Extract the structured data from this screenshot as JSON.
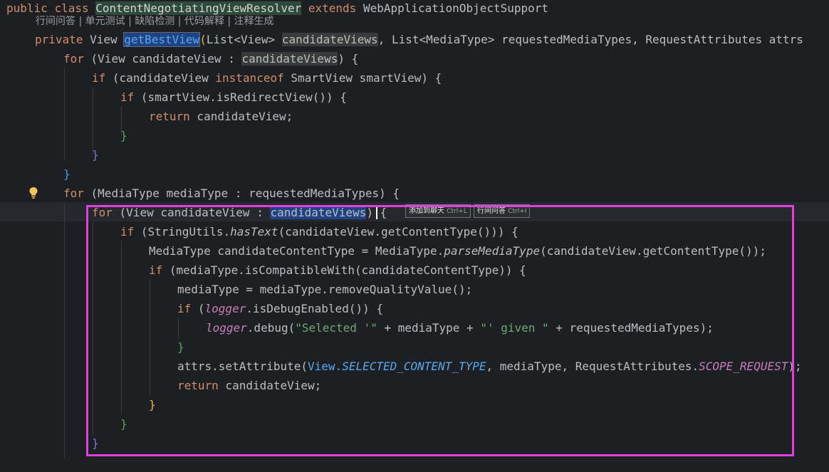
{
  "class_line": {
    "public": "public",
    "class": "class",
    "class_name": "ContentNegotiatingViewResolver",
    "extends": "extends",
    "superclass": "WebApplicationObjectSupport"
  },
  "inlay_hints": {
    "ask": "行间问答",
    "unit_test": "单元测试",
    "bug_detect": "缺陷检测",
    "explain": "代码解释",
    "comment": "注释生成",
    "separator": " | "
  },
  "method_line": {
    "private": "private",
    "return_type": "View",
    "method_name": "getBestView",
    "params_a": "List<View> ",
    "param_candidate_views": "candidateViews",
    "params_b": ", List<MediaType> requestedMediaTypes, RequestAttributes attrs"
  },
  "lines": {
    "l3_a": "for",
    "l3_b": " (View candidateView : ",
    "l3_c": "candidateViews",
    "l3_d": ") {",
    "l4_a": "if",
    "l4_b": " (candidateView ",
    "l4_c": "instanceof",
    "l4_d": " SmartView smartView) {",
    "l5_a": "if",
    "l5_b": " (smartView.isRedirectView()) {",
    "l6_a": "return",
    "l6_b": " candidateView;",
    "l7": "}",
    "l8": "}",
    "l9": "}",
    "l10_a": "for",
    "l10_b": " (MediaType mediaType : requestedMediaTypes) {",
    "l11_a": "for",
    "l11_b": " (View candidateView : ",
    "l11_c": "candidateViews",
    "l11_d": ") {",
    "l12_a": "if",
    "l12_b": " (StringUtils.",
    "l12_c": "hasText",
    "l12_d": "(candidateView.getContentType())) {",
    "l13_a": "MediaType candidateContentType = MediaType.",
    "l13_b": "parseMediaType",
    "l13_c": "(candidateView.getContentType());",
    "l14_a": "if",
    "l14_b": " (mediaType.isCompatibleWith(candidateContentType)) {",
    "l15": "mediaType = mediaType.removeQualityValue();",
    "l16_a": "if",
    "l16_b": " (",
    "l16_c": "logger",
    "l16_d": ".isDebugEnabled()) {",
    "l17_a": "logger",
    "l17_b": ".debug(",
    "l17_c": "\"Selected '\"",
    "l17_d": " + mediaType + ",
    "l17_e": "\"' given \"",
    "l17_f": " + requestedMediaTypes);",
    "l18": "}",
    "l19_a": "attrs.setAttribute(",
    "l19_b": "View.",
    "l19_c": "SELECTED_CONTENT_TYPE",
    "l19_d": ", mediaType, RequestAttributes.",
    "l19_e": "SCOPE_REQUEST",
    "l19_f": ");",
    "l20_a": "return",
    "l20_b": " candidateView;",
    "l21": "}",
    "l22": "}",
    "l23": "}"
  },
  "inline_actions": {
    "add_to_chat": "添加到聊天",
    "add_to_chat_shortcut": "Ctrl+L",
    "ask_inline": "行间问答",
    "ask_inline_shortcut": "Ctrl+I"
  },
  "colors": {
    "keyword": "#cf8e6d",
    "method_decl": "#56a8f5",
    "string": "#6aab73",
    "static_field": "#c77dbb",
    "highlight_frame": "#e040e0"
  },
  "icons": {
    "gutter": "lightbulb-icon"
  }
}
